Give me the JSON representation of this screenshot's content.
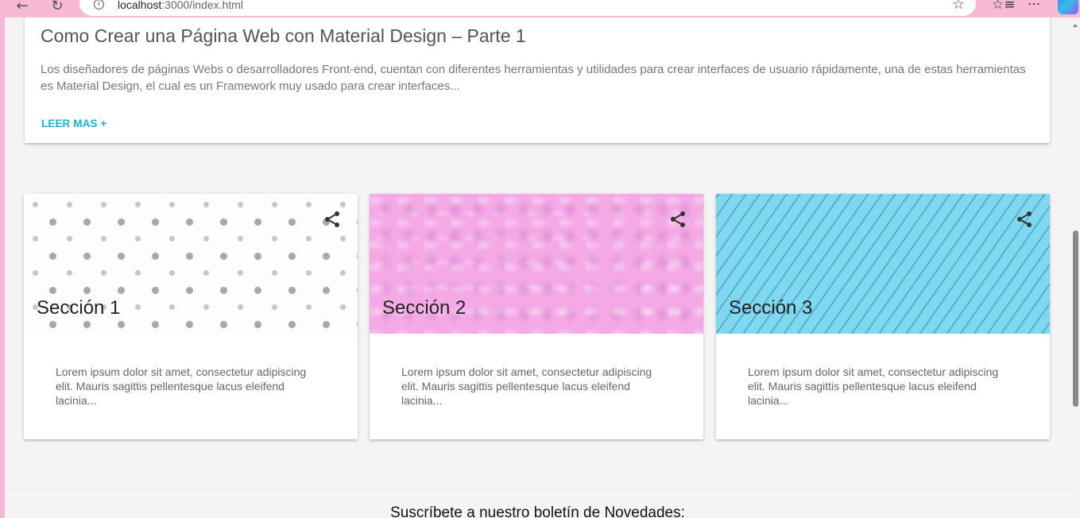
{
  "browser": {
    "back_icon": "←",
    "reload_icon": "↻",
    "info_icon": "i",
    "url_host": "localhost",
    "url_path": ":3000/index.html",
    "favorite_icon": "☆",
    "favorites_list_icon": "☆≡",
    "more_icon": "···"
  },
  "article": {
    "title": "Como Crear una Página Web con Material Design – Parte 1",
    "excerpt": "Los diseñadores de páginas Webs o desarrolladores Front-end, cuentan con diferentes herramientas y utilidades para crear interfaces de usuario rápidamente, una de estas herramientas es Material Design, el cual es un Framework muy usado para crear interfaces...",
    "read_more": "LEER MAS +"
  },
  "sections": [
    {
      "title": "Sección 1",
      "text": "Lorem ipsum dolor sit amet, consectetur adipiscing elit. Mauris sagittis pellentesque lacus eleifend lacinia...",
      "pattern": "gray-dots",
      "share_icon": "share-icon"
    },
    {
      "title": "Sección 2",
      "text": "Lorem ipsum dolor sit amet, consectetur adipiscing elit. Mauris sagittis pellentesque lacus eleifend lacinia...",
      "pattern": "pink-texture",
      "share_icon": "share-icon"
    },
    {
      "title": "Sección 3",
      "text": "Lorem ipsum dolor sit amet, consectetur adipiscing elit. Mauris sagittis pellentesque lacus eleifend lacinia...",
      "pattern": "blue-diagonal-stripes",
      "share_icon": "share-icon"
    }
  ],
  "newsletter": {
    "title": "Suscríbete a nuestro boletín de Novedades:"
  },
  "colors": {
    "accent": "#1ab3d1",
    "browser_frame": "#f4b8d3",
    "page_background": "#f4f4f4"
  }
}
